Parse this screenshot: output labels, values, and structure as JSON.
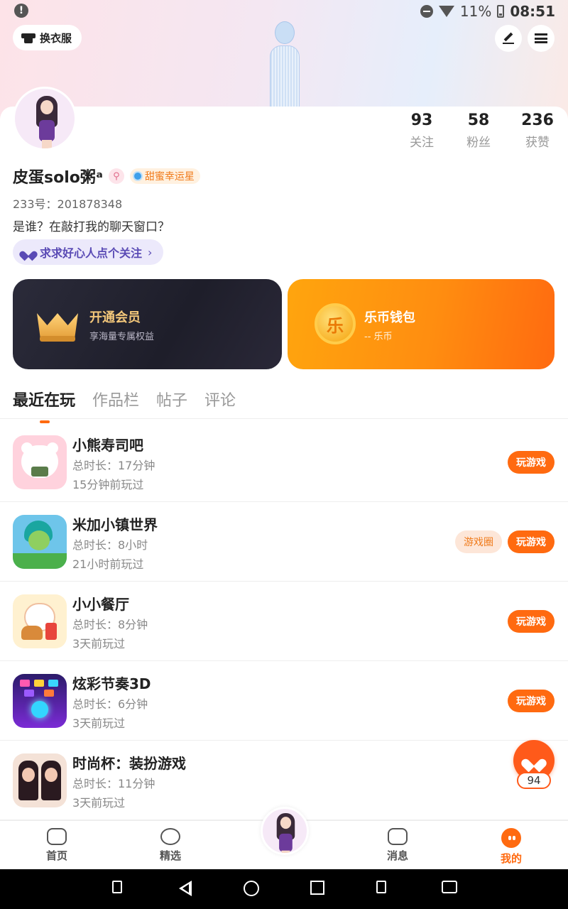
{
  "status_bar": {
    "battery": "11%",
    "time": "08:51",
    "icons": [
      "alert-icon",
      "dnd-icon",
      "wifi-icon",
      "battery-icon"
    ]
  },
  "header": {
    "outfit_label": "换衣服",
    "edit_icon": "pen-icon",
    "menu_icon": "menu-icon"
  },
  "profile": {
    "username": "皮蛋solo粥ᵃ",
    "badge_label": "甜蜜幸运星",
    "uid": "233号：201878348",
    "bio": "是谁？在敲打我的聊天窗口？",
    "follow_prompt": "求求好心人点个关注"
  },
  "stats": [
    {
      "value": "93",
      "label": "关注"
    },
    {
      "value": "58",
      "label": "粉丝"
    },
    {
      "value": "236",
      "label": "获赞"
    }
  ],
  "promo": {
    "vip": {
      "title": "开通会员",
      "subtitle": "享海量专属权益"
    },
    "wallet": {
      "title": "乐币钱包",
      "subtitle": "-- 乐币",
      "coin_glyph": "乐"
    }
  },
  "tabs": [
    "最近在玩",
    "作品栏",
    "帖子",
    "评论"
  ],
  "games": [
    {
      "name": "小熊寿司吧",
      "duration": "总时长：17分钟",
      "last_played": "15分钟前玩过",
      "play_label": "玩游戏"
    },
    {
      "name": "米加小镇世界",
      "duration": "总时长：8小时",
      "last_played": "21小时前玩过",
      "play_label": "玩游戏",
      "circle_label": "游戏圈"
    },
    {
      "name": "小小餐厅",
      "duration": "总时长：8分钟",
      "last_played": "3天前玩过",
      "play_label": "玩游戏"
    },
    {
      "name": "炫彩节奏3D",
      "duration": "总时长：6分钟",
      "last_played": "3天前玩过",
      "play_label": "玩游戏"
    },
    {
      "name": "时尚杯：装扮游戏",
      "duration": "总时长：11分钟",
      "last_played": "3天前玩过"
    }
  ],
  "float_like": {
    "count": "94"
  },
  "bottom_nav": [
    {
      "label": "首页",
      "icon": "gamepad-icon"
    },
    {
      "label": "精选",
      "icon": "heart-chat-icon"
    },
    {
      "label": "消息",
      "icon": "message-icon"
    },
    {
      "label": "我的",
      "icon": "me-icon",
      "active": true
    }
  ],
  "colors": {
    "accent": "#ff6a10",
    "vip_gold": "#f3c77a",
    "follow_purple": "#5a4bb5"
  }
}
